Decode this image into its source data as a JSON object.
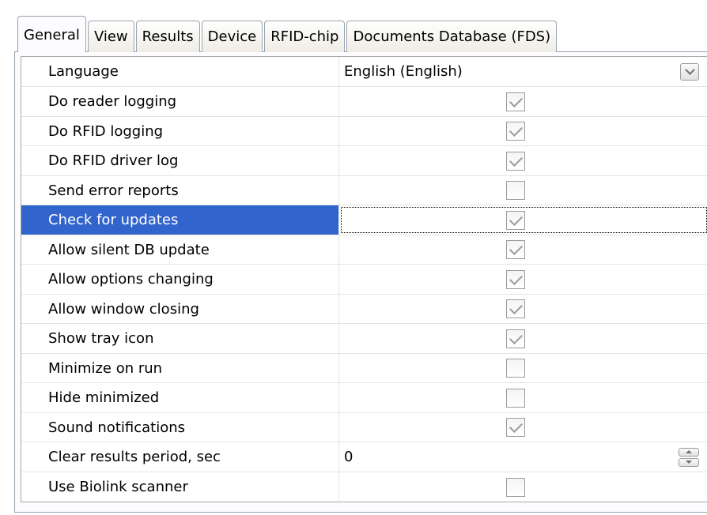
{
  "tabs": [
    {
      "label": "General",
      "active": true
    },
    {
      "label": "View",
      "active": false
    },
    {
      "label": "Results",
      "active": false
    },
    {
      "label": "Device",
      "active": false
    },
    {
      "label": "RFID-chip",
      "active": false
    },
    {
      "label": "Documents Database (FDS)",
      "active": false
    }
  ],
  "properties": {
    "language": {
      "label": "Language",
      "value": "English (English)",
      "icon": "chevron-down-icon"
    },
    "do_reader_logging": {
      "label": "Do reader logging",
      "checked": true
    },
    "do_rfid_logging": {
      "label": "Do RFID logging",
      "checked": true
    },
    "do_rfid_driver_log": {
      "label": "Do RFID driver log",
      "checked": true
    },
    "send_error_reports": {
      "label": "Send error reports",
      "checked": false
    },
    "check_for_updates": {
      "label": "Check for updates",
      "checked": true,
      "selected": true
    },
    "allow_silent_db_update": {
      "label": "Allow silent DB update",
      "checked": true
    },
    "allow_options_changing": {
      "label": "Allow options changing",
      "checked": true
    },
    "allow_window_closing": {
      "label": "Allow window closing",
      "checked": true
    },
    "show_tray_icon": {
      "label": "Show tray icon",
      "checked": true
    },
    "minimize_on_run": {
      "label": "Minimize on run",
      "checked": false
    },
    "hide_minimized": {
      "label": "Hide minimized",
      "checked": false
    },
    "sound_notifications": {
      "label": "Sound notifications",
      "checked": true
    },
    "clear_results_period": {
      "label": "Clear results period, sec",
      "value": "0",
      "icon": "spinner-updown-icon"
    },
    "use_biolink_scanner": {
      "label": "Use Biolink scanner",
      "checked": false
    }
  },
  "colors": {
    "selection": "#3264cd",
    "tab_border": "#98a3ae",
    "grid_line": "#e4e4e4",
    "checkmark": "#9a9a9a"
  }
}
